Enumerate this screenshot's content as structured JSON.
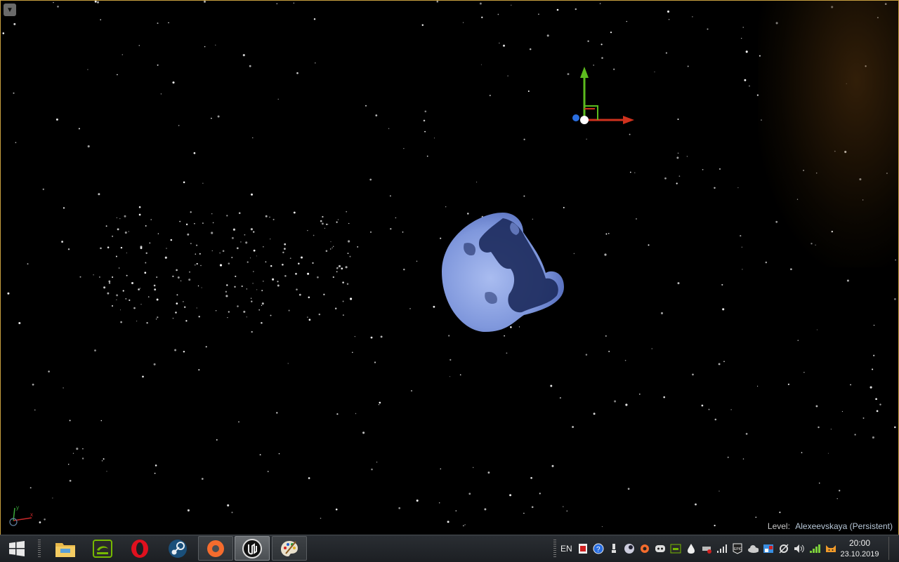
{
  "viewport": {
    "menu_icon": "chevron-down-icon",
    "level_prefix": "Level:",
    "level_name": "Alexeevskaya (Persistent)",
    "axis_labels": {
      "x": "x",
      "y": "y",
      "z": "z"
    }
  },
  "colors": {
    "sky": "#000000",
    "moon_light": "#8fa6e6",
    "moon_dark": "#1c2a5c",
    "gizmo_x": "#d0321e",
    "gizmo_y": "#5cbb1e",
    "gizmo_z": "#2a6ee0",
    "viewport_border": "#c8a040",
    "taskbar": "#22262a"
  },
  "taskbar": {
    "start_icon": "windows-logo-icon",
    "pinned": [
      {
        "name": "file-explorer",
        "icon": "folder-icon",
        "state": "normal"
      },
      {
        "name": "nvidia",
        "icon": "nvidia-icon",
        "state": "normal"
      },
      {
        "name": "opera",
        "icon": "opera-icon",
        "state": "normal"
      },
      {
        "name": "steam",
        "icon": "steam-icon",
        "state": "normal"
      },
      {
        "name": "origin",
        "icon": "origin-icon",
        "state": "running"
      },
      {
        "name": "unreal-engine",
        "icon": "unreal-icon",
        "state": "active"
      },
      {
        "name": "paint",
        "icon": "paint-palette-icon",
        "state": "running"
      }
    ],
    "tray": {
      "language": "EN",
      "icons": [
        "acrobat-icon",
        "help-icon",
        "usb-icon",
        "steam-tray-icon",
        "origin-tray-icon",
        "discord-icon",
        "nvidia-tray-icon",
        "droplet-icon",
        "network-drive-icon",
        "signal-icon",
        "epic-games-icon",
        "cloud-icon",
        "action-center-icon",
        "sync-icon",
        "volume-icon",
        "wifi-icon",
        "cat-icon"
      ]
    },
    "clock": {
      "time": "20:00",
      "date": "23.10.2019"
    }
  }
}
